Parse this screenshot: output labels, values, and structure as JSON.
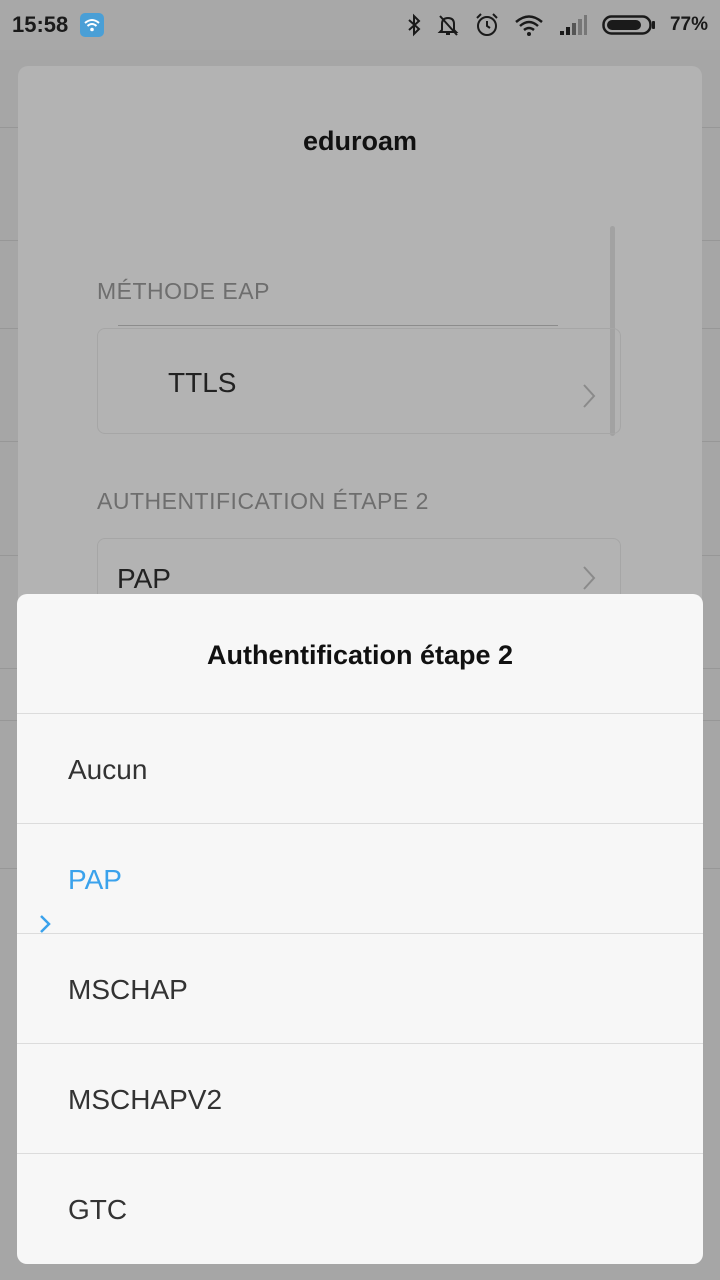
{
  "status_bar": {
    "time": "15:58",
    "battery_percent": "77%",
    "icons": [
      "wifi-notification-icon",
      "bluetooth-icon",
      "notifications-muted-icon",
      "alarm-icon",
      "wifi-signal-icon",
      "cellular-signal-icon",
      "battery-icon"
    ]
  },
  "dialog": {
    "title": "eduroam",
    "eap_method": {
      "label": "MÉTHODE EAP",
      "value": "TTLS"
    },
    "phase2": {
      "label": "AUTHENTIFICATION ÉTAPE 2",
      "value": "PAP"
    }
  },
  "sheet": {
    "title": "Authentification étape 2",
    "selected": "PAP",
    "options": [
      {
        "label": "Aucun"
      },
      {
        "label": "PAP"
      },
      {
        "label": "MSCHAP"
      },
      {
        "label": "MSCHAPV2"
      },
      {
        "label": "GTC"
      }
    ]
  },
  "colors": {
    "accent": "#3aa2ec",
    "scrim": "#a3a3a3",
    "sheet_bg": "#f7f7f7"
  }
}
